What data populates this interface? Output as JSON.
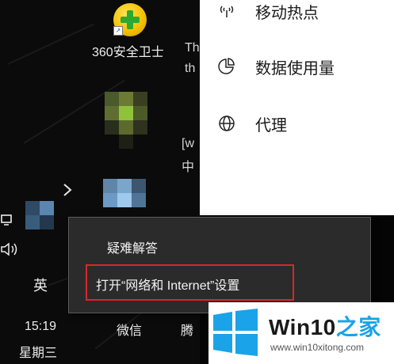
{
  "desktop": {
    "icons": [
      {
        "label": "360安全卫士"
      },
      {
        "label": "Th"
      },
      {
        "label": "th"
      },
      {
        "label": "[w"
      },
      {
        "label": "中"
      }
    ],
    "taskbar_labels": {
      "wechat": "微信",
      "tencent": "腾"
    }
  },
  "tray": {
    "ime_label": "英",
    "time": "15:19",
    "weekday": "星期三",
    "chevron_icon": "chevron-right-icon",
    "volume_icon": "speaker-icon",
    "network_icon": "network-icon"
  },
  "settings_panel": {
    "items": [
      {
        "label": "移动热点",
        "icon": "hotspot-icon"
      },
      {
        "label": "数据使用量",
        "icon": "data-usage-icon"
      },
      {
        "label": "代理",
        "icon": "globe-icon"
      }
    ]
  },
  "context_menu": {
    "items": [
      {
        "label": "疑难解答"
      },
      {
        "label": "打开“网络和 Internet”设置"
      }
    ],
    "highlight_color": "#d9262c"
  },
  "watermark": {
    "brand_prefix": "Win10",
    "brand_suffix": "之家",
    "site": "www.win10xitong.com",
    "accent_color": "#1aa3e8"
  }
}
